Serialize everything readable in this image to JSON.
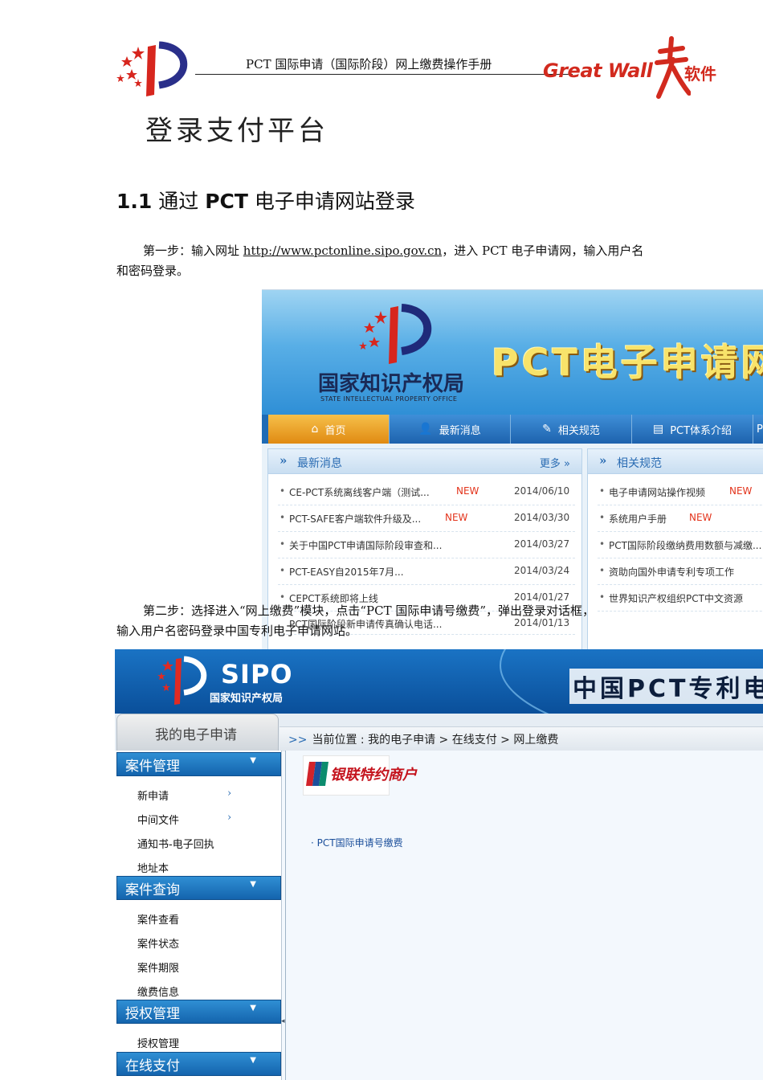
{
  "header": {
    "title": "PCT 国际申请（国际阶段）网上缴费操作手册",
    "company_logo_text": "Great Wall",
    "company_logo_cn": "长城",
    "company_logo_suffix": "软件"
  },
  "heading": "登录支付平台",
  "section": {
    "number": "1.1",
    "title_pre": "通过",
    "title_bold": "PCT",
    "title_post": "电子申请网站登录"
  },
  "step1": {
    "pre": "第一步：输入网址",
    "url": "http://www.pctonline.sipo.gov.cn",
    "post": "，进入 PCT 电子申请网，输入用户名",
    "line2": "和密码登录。"
  },
  "step2": {
    "line1": "第二步：选择进入“网上缴费”模块，点击“PCT 国际申请号缴费”，弹出登录对话框，",
    "line2": "输入用户名密码登录中国专利电子申请网站。"
  },
  "screenshot1": {
    "org_cn": "国家知识产权局",
    "org_en": "STATE INTELLECTUAL PROPERTY OFFICE",
    "site_title": "PCT电子申请网",
    "nav": [
      {
        "label": "首页",
        "icon": "home-icon",
        "glyph": "⌂"
      },
      {
        "label": "最新消息",
        "icon": "user-icon",
        "glyph": "👤"
      },
      {
        "label": "相关规范",
        "icon": "pen-icon",
        "glyph": "✎"
      },
      {
        "label": "PCT体系介绍",
        "icon": "document-icon",
        "glyph": "▤"
      },
      {
        "label": "P",
        "icon": "",
        "glyph": ""
      }
    ],
    "news_panel": {
      "title": "最新消息",
      "more": "更多",
      "items": [
        {
          "text": "CE-PCT系统离线客户端（测试...",
          "new": "NEW",
          "date": "2014/06/10"
        },
        {
          "text": "PCT-SAFE客户端软件升级及...",
          "new": "NEW",
          "date": "2014/03/30"
        },
        {
          "text": "关于中国PCT申请国际阶段审查和...",
          "new": "",
          "date": "2014/03/27"
        },
        {
          "text": "PCT-EASY自2015年7月...",
          "new": "",
          "date": "2014/03/24"
        },
        {
          "text": "CEPCT系统即将上线",
          "new": "",
          "date": "2014/01/27"
        },
        {
          "text": "PCT国际阶段新申请传真确认电话...",
          "new": "",
          "date": "2014/01/13"
        }
      ]
    },
    "rules_panel": {
      "title": "相关规范",
      "items": [
        {
          "text": "电子申请网站操作视频",
          "new": "NEW"
        },
        {
          "text": "系统用户手册",
          "new": "NEW"
        },
        {
          "text": "PCT国际阶段缴纳费用数额与减缴...",
          "new": ""
        },
        {
          "text": "资助向国外申请专利专项工作",
          "new": ""
        },
        {
          "text": "世界知识产权组织PCT中文资源",
          "new": ""
        }
      ]
    }
  },
  "screenshot2": {
    "brand": "SIPO",
    "brand_cn": "国家知识产权局",
    "site_title": "中国PCT专利电",
    "my_tab": "我的电子申请",
    "breadcrumb_prefix": ">>",
    "breadcrumb": "当前位置 : 我的电子申请 > 在线支付 > 网上缴费",
    "sidebar": [
      {
        "title": "案件管理",
        "items": [
          "新申请",
          "中间文件",
          "通知书-电子回执",
          "地址本"
        ]
      },
      {
        "title": "案件查询",
        "items": [
          "案件查看",
          "案件状态",
          "案件期限",
          "缴费信息"
        ]
      },
      {
        "title": "授权管理",
        "items": [
          "授权管理"
        ]
      },
      {
        "title": "在线支付",
        "items": []
      }
    ],
    "merchant_label": "银联特约商户",
    "pay_link": "· PCT国际申请号缴费"
  },
  "colors": {
    "brand_red": "#d22a1e",
    "nav_blue": "#1f6bb5",
    "nav_active": "#e08a12",
    "new_badge": "#e3341c",
    "link_blue": "#1a4e9a"
  }
}
